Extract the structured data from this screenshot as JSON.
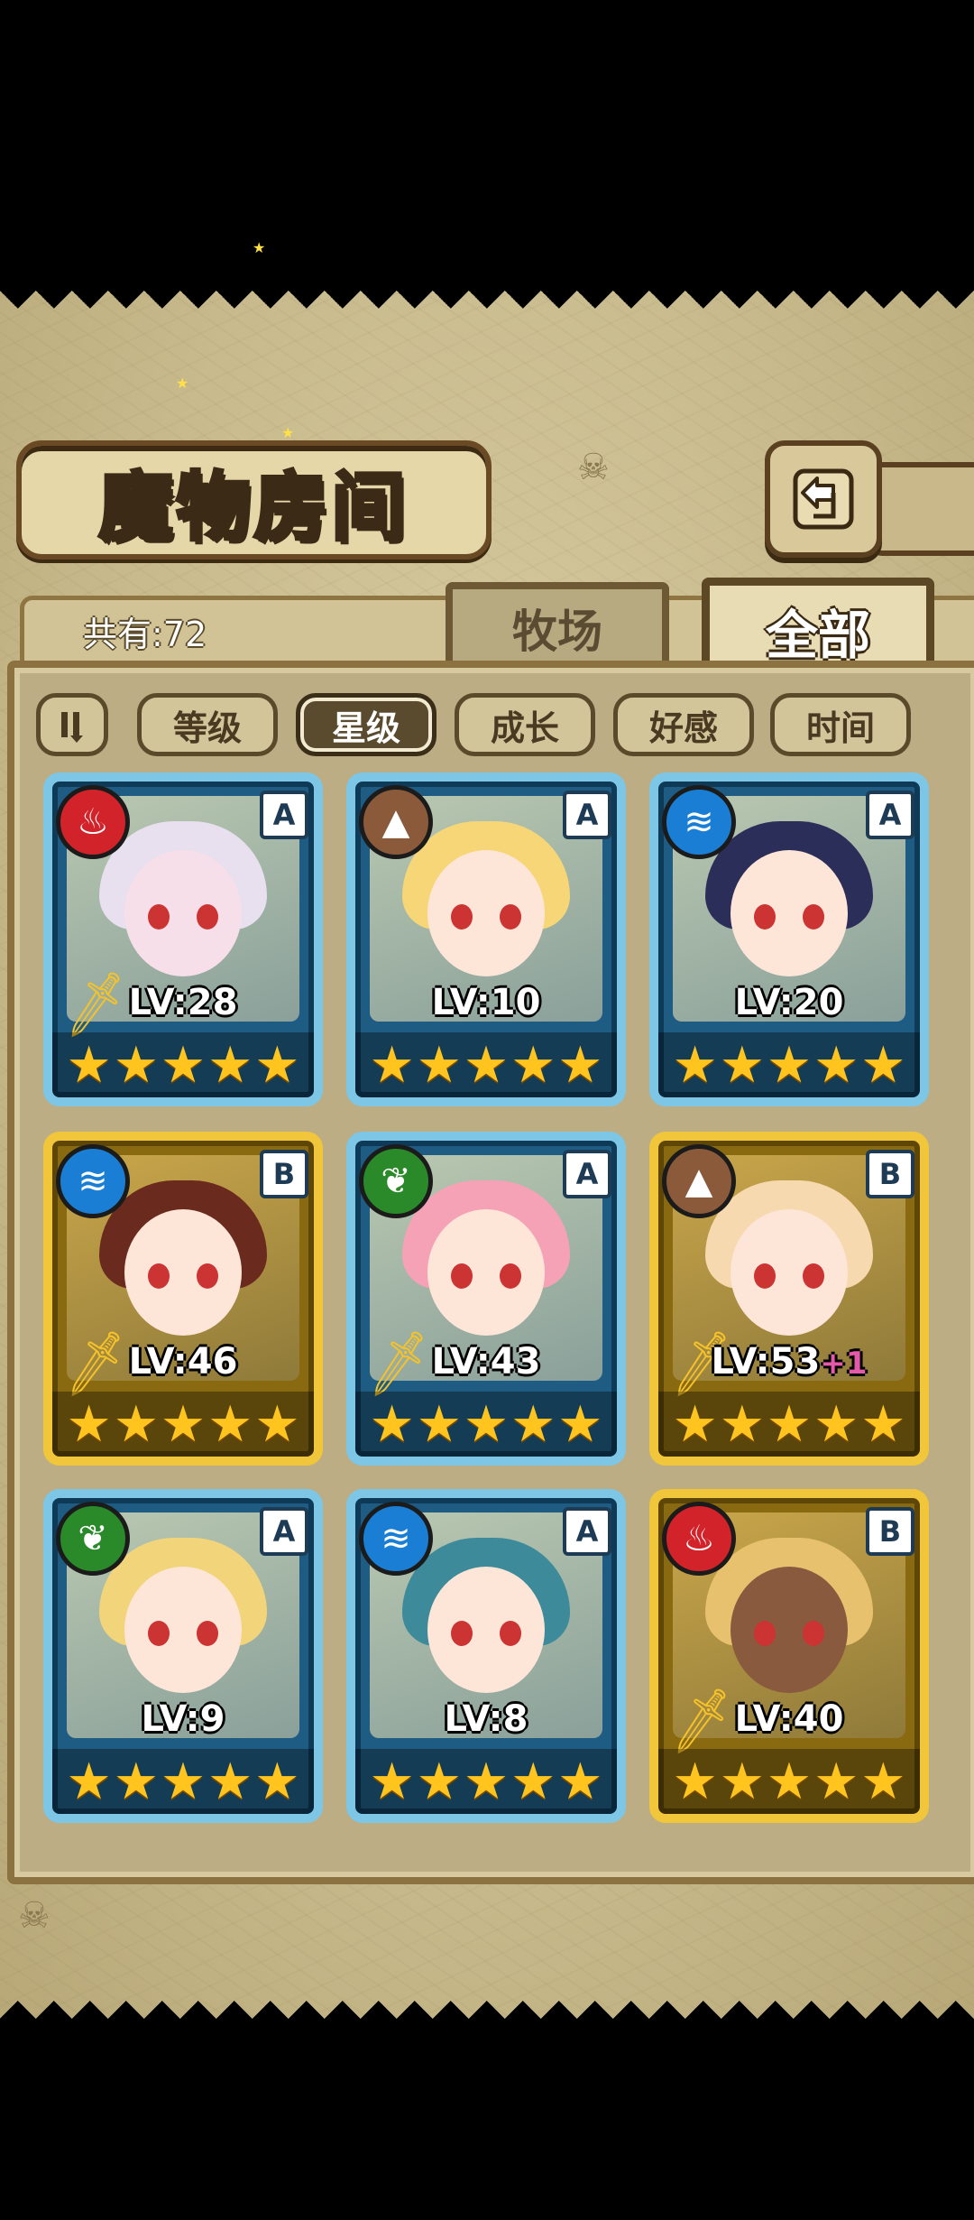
{
  "title": "魔物房间",
  "back_icon": "back-arrow-icon",
  "total": "共有:72",
  "tabs": {
    "ranch": "牧场",
    "all": "全部"
  },
  "sort": {
    "order_icon": "sort-order-icon",
    "buttons": [
      "等级",
      "星级",
      "成长",
      "好感",
      "时间"
    ],
    "active": "星级"
  },
  "monsters": [
    {
      "level": "LV:28",
      "plus": "",
      "element": "fire",
      "rank": "A",
      "frame": "blue",
      "stars": 5
    },
    {
      "level": "LV:10",
      "plus": "",
      "element": "earth",
      "rank": "A",
      "frame": "blue",
      "stars": 5
    },
    {
      "level": "LV:20",
      "plus": "",
      "element": "water",
      "rank": "A",
      "frame": "blue",
      "stars": 5
    },
    {
      "level": "LV:46",
      "plus": "",
      "element": "water",
      "rank": "B",
      "frame": "gold",
      "stars": 5
    },
    {
      "level": "LV:43",
      "plus": "",
      "element": "grass",
      "rank": "A",
      "frame": "blue",
      "stars": 5
    },
    {
      "level": "LV:53",
      "plus": "+1",
      "element": "earth",
      "rank": "B",
      "frame": "gold",
      "stars": 5
    },
    {
      "level": "LV:9",
      "plus": "",
      "element": "grass",
      "rank": "A",
      "frame": "blue",
      "stars": 5
    },
    {
      "level": "LV:8",
      "plus": "",
      "element": "water",
      "rank": "A",
      "frame": "blue",
      "stars": 5
    },
    {
      "level": "LV:40",
      "plus": "",
      "element": "fire",
      "rank": "B",
      "frame": "gold",
      "stars": 5
    }
  ],
  "element_glyphs": {
    "fire": "♨",
    "water": "≋",
    "earth": "▲",
    "grass": "❦"
  },
  "colors": {
    "blue_frame": "#7dc6e6",
    "gold_frame": "#f2c63a",
    "star": "#ffc51e",
    "parchment": "#c7b98b"
  }
}
